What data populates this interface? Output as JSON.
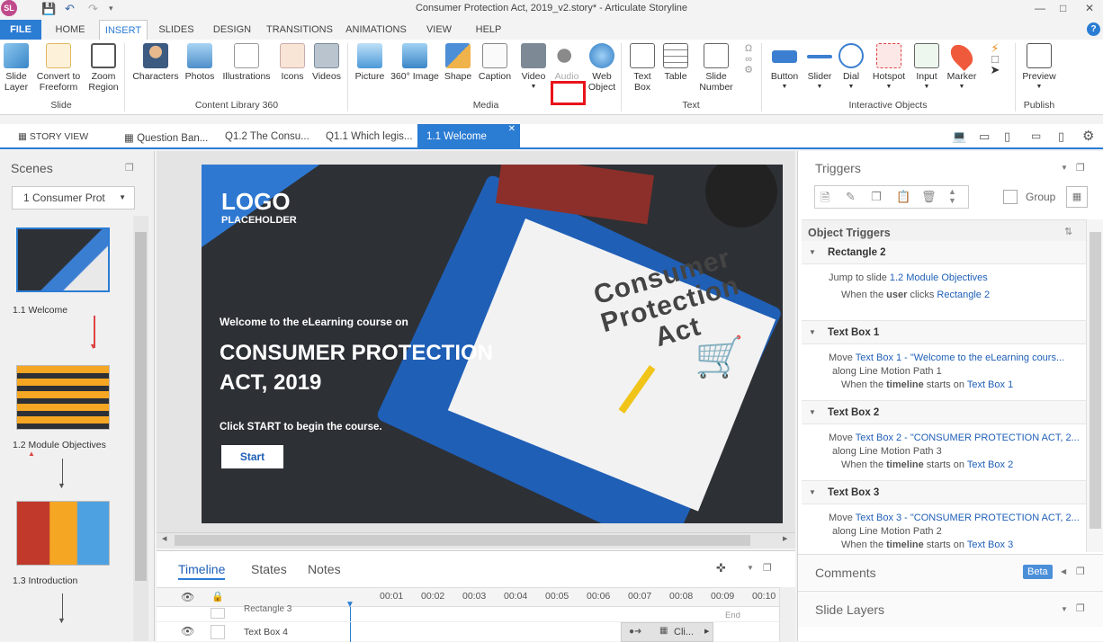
{
  "title_bar": {
    "app_title": "Consumer Protection Act, 2019_v2.story* - Articulate Storyline",
    "app_badge": "SL"
  },
  "menu": {
    "file": "FILE",
    "tabs": [
      "HOME",
      "INSERT",
      "SLIDES",
      "DESIGN",
      "TRANSITIONS",
      "ANIMATIONS",
      "VIEW",
      "HELP"
    ]
  },
  "ribbon": {
    "buttons": {
      "slide_layer": "Slide Layer",
      "convert_freeform": "Convert to Freeform",
      "zoom_region": "Zoom Region",
      "characters": "Characters",
      "photos": "Photos",
      "illustrations": "Illustrations",
      "icons": "Icons",
      "videos": "Videos",
      "picture": "Picture",
      "image360": "360° Image",
      "shape": "Shape",
      "caption": "Caption",
      "video": "Video",
      "audio": "Audio",
      "web_object": "Web Object",
      "text_box": "Text Box",
      "table": "Table",
      "slide_number": "Slide Number",
      "button": "Button",
      "slider": "Slider",
      "dial": "Dial",
      "hotspot": "Hotspot",
      "input": "Input",
      "marker": "Marker",
      "preview": "Preview"
    },
    "groups": {
      "slide": "Slide",
      "content_library": "Content Library 360",
      "media": "Media",
      "text": "Text",
      "interactive": "Interactive Objects",
      "publish": "Publish"
    }
  },
  "doc_tabs": {
    "story_view": "STORY VIEW",
    "tabs": [
      "Question Ban...",
      "Q1.2 The Consu...",
      "Q1.1 Which legis...",
      "1.1 Welcome"
    ]
  },
  "scenes": {
    "header": "Scenes",
    "dropdown": "1 Consumer Prot",
    "slides": [
      "1.1 Welcome",
      "1.2 Module Objectives",
      "1.3 Introduction"
    ]
  },
  "slide": {
    "logo": "LOGO",
    "logo_sub": "PLACEHOLDER",
    "welcome": "Welcome to the eLearning course on",
    "title_line1": "CONSUMER PROTECTION",
    "title_line2": "ACT, 2019",
    "instruction": "Click START to begin the course.",
    "start": "Start",
    "clip_line1": "Consumer",
    "clip_line2": "Protection",
    "clip_line3": "Act"
  },
  "timeline": {
    "tabs": [
      "Timeline",
      "States",
      "Notes"
    ],
    "ticks": [
      "00:01",
      "00:02",
      "00:03",
      "00:04",
      "00:05",
      "00:06",
      "00:07",
      "00:08",
      "00:09",
      "00:10"
    ],
    "rows": [
      "Rectangle 3",
      "Text Box 4"
    ],
    "end_label": "End",
    "clip_label": "Cli..."
  },
  "triggers": {
    "header": "Triggers",
    "group_label": "Group",
    "object_triggers": "Object Triggers",
    "items": [
      {
        "name": "Rectangle 2",
        "l1a": "Jump to slide ",
        "l1b": "1.2 Module Objectives",
        "l2": "",
        "l3a": "When the ",
        "l3b": "user",
        "l3c": " clicks ",
        "l3d": "Rectangle 2"
      },
      {
        "name": "Text Box 1",
        "l1a": "Move ",
        "l1b": "Text Box 1 - \"Welcome to the eLearning cours...",
        "l2": "along Line Motion Path 1",
        "l3a": "When the ",
        "l3b": "timeline",
        "l3c": " starts on ",
        "l3d": "Text Box 1"
      },
      {
        "name": "Text Box 2",
        "l1a": "Move ",
        "l1b": "Text Box 2 - \"CONSUMER PROTECTION ACT, 2...",
        "l2": "along Line Motion Path 3",
        "l3a": "When the ",
        "l3b": "timeline",
        "l3c": " starts on ",
        "l3d": "Text Box 2"
      },
      {
        "name": "Text Box 3",
        "l1a": "Move ",
        "l1b": "Text Box 3 - \"CONSUMER PROTECTION ACT, 2...",
        "l2": "along Line Motion Path 2",
        "l3a": "When the ",
        "l3b": "timeline",
        "l3c": " starts on ",
        "l3d": "Text Box 3"
      }
    ],
    "comments": "Comments",
    "beta": "Beta",
    "slide_layers": "Slide Layers"
  },
  "colors": {
    "accent": "#2b7cd3",
    "highlight": "#e8141b",
    "slide_bg": "#2d3035"
  }
}
